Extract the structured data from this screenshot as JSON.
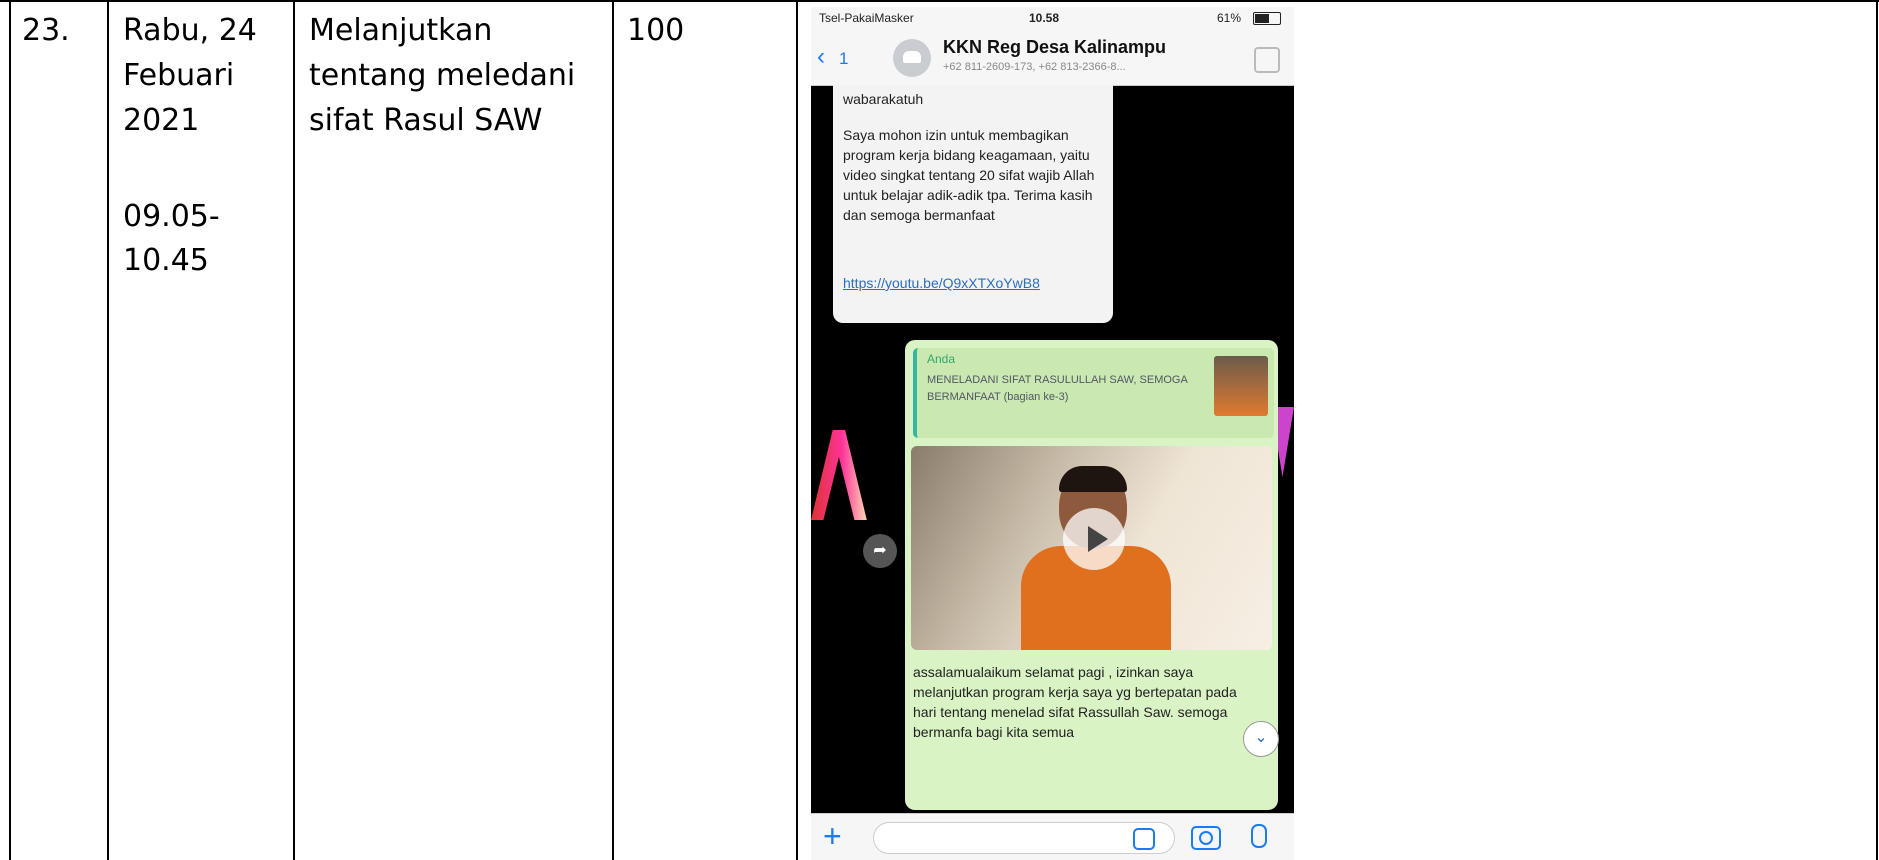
{
  "row": {
    "number": "23.",
    "date_lines": [
      "Rabu, 24",
      "Febuari",
      "2021"
    ],
    "time_lines": [
      "09.05-",
      "10.45"
    ],
    "activity_lines": [
      "Melanjutkan",
      "tentang meledani",
      "sifat Rasul SAW"
    ],
    "score": "100"
  },
  "phone": {
    "status": {
      "carrier": "Tsel-PakaiMasker",
      "time": "10.58",
      "battery": "61%"
    },
    "chat": {
      "back_count": "1",
      "title": "KKN Reg Desa Kalinampu",
      "subtitle": "+62 811-2609-173, +62 813-2366-8..."
    },
    "incoming": {
      "first_line": "wabarakatuh",
      "body": "Saya mohon izin untuk membagikan program kerja bidang keagamaan, yaitu video singkat tentang 20 sifat wajib Allah untuk belajar adik-adik tpa. Terima kasih dan semoga bermanfaat",
      "link": "https://youtu.be/Q9xXTXoYwB8"
    },
    "outgoing": {
      "reply_name": "Anda",
      "reply_text": "MENELADANI SIFAT RASULULLAH SAW, SEMOGA BERMANFAAT (bagian ke-3)",
      "message": "assalamualaikum selamat pagi , izinkan saya melanjutkan program kerja saya yg bertepatan pada hari tentang menelad sifat Rassullah Saw. semoga bermanfa bagi kita semua"
    }
  }
}
